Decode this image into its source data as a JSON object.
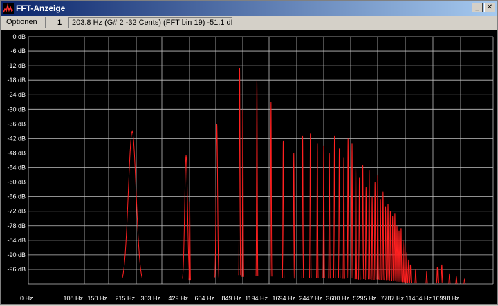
{
  "window": {
    "title": "FFT-Anzeige",
    "minimize_glyph": "_",
    "maximize_glyph": "□",
    "close_glyph": "✕",
    "app_icon": "spectrum-icon"
  },
  "toolbar": {
    "options_label": "Optionen",
    "channel_label": "1",
    "readout": "203.8 Hz (G# 2 -32 Cents) (FFT bin 19) -51.1 dB"
  },
  "colors": {
    "trace": "#ff2020",
    "grid": "#c0c0c0",
    "background": "#000000"
  },
  "chart_data": {
    "type": "line",
    "title": "",
    "xlabel": "",
    "ylabel": "",
    "x_scale": "log",
    "x_ticks": [
      "0 Hz",
      "108 Hz",
      "150 Hz",
      "215 Hz",
      "303 Hz",
      "429 Hz",
      "604 Hz",
      "849 Hz",
      "1194 Hz",
      "1694 Hz",
      "2447 Hz",
      "3600 Hz",
      "5295 Hz",
      "7787 Hz",
      "11454 Hz",
      "16998 Hz"
    ],
    "y_ticks": [
      "0 dB",
      "-6 dB",
      "-12 dB",
      "-18 dB",
      "-24 dB",
      "-30 dB",
      "-36 dB",
      "-42 dB",
      "-48 dB",
      "-54 dB",
      "-60 dB",
      "-66 dB",
      "-72 dB",
      "-78 dB",
      "-84 dB",
      "-90 dB",
      "-96 dB"
    ],
    "ylim": [
      -102,
      0
    ],
    "grid": true,
    "floor_db": -102,
    "peaks": [
      {
        "freq": 204,
        "db": -39,
        "width": 0.13
      },
      {
        "freq": 411,
        "db": -49,
        "width": 0.045
      },
      {
        "freq": 430,
        "db": -68,
        "width": 0.01
      },
      {
        "freq": 612,
        "db": -36,
        "width": 0.025
      },
      {
        "freq": 816,
        "db": -13,
        "width": 0.012
      },
      {
        "freq": 850,
        "db": -30,
        "width": 0.008
      },
      {
        "freq": 1020,
        "db": -18,
        "width": 0.012
      },
      {
        "freq": 1224,
        "db": -27,
        "width": 0.01
      },
      {
        "freq": 1428,
        "db": -43,
        "width": 0.01
      },
      {
        "freq": 1632,
        "db": -48,
        "width": 0.009
      },
      {
        "freq": 1836,
        "db": -41,
        "width": 0.009
      },
      {
        "freq": 2040,
        "db": -40,
        "width": 0.008
      },
      {
        "freq": 2244,
        "db": -44,
        "width": 0.008
      },
      {
        "freq": 2448,
        "db": -45,
        "width": 0.008
      },
      {
        "freq": 2652,
        "db": -48,
        "width": 0.008
      },
      {
        "freq": 2856,
        "db": -41,
        "width": 0.007
      },
      {
        "freq": 3060,
        "db": -46,
        "width": 0.007
      },
      {
        "freq": 3264,
        "db": -50,
        "width": 0.007
      },
      {
        "freq": 3468,
        "db": -42,
        "width": 0.007
      },
      {
        "freq": 3672,
        "db": -44,
        "width": 0.007
      },
      {
        "freq": 3876,
        "db": -54,
        "width": 0.007
      },
      {
        "freq": 4080,
        "db": -58,
        "width": 0.007
      },
      {
        "freq": 4284,
        "db": -53,
        "width": 0.006
      },
      {
        "freq": 4488,
        "db": -62,
        "width": 0.006
      },
      {
        "freq": 4692,
        "db": -55,
        "width": 0.006
      },
      {
        "freq": 4896,
        "db": -66,
        "width": 0.006
      },
      {
        "freq": 5100,
        "db": -60,
        "width": 0.006
      },
      {
        "freq": 5304,
        "db": -57,
        "width": 0.006
      },
      {
        "freq": 5508,
        "db": -67,
        "width": 0.006
      },
      {
        "freq": 5712,
        "db": -64,
        "width": 0.006
      },
      {
        "freq": 5916,
        "db": -70,
        "width": 0.006
      },
      {
        "freq": 6120,
        "db": -69,
        "width": 0.006
      },
      {
        "freq": 6324,
        "db": -72,
        "width": 0.006
      },
      {
        "freq": 6528,
        "db": -74,
        "width": 0.006
      },
      {
        "freq": 6732,
        "db": -73,
        "width": 0.006
      },
      {
        "freq": 6936,
        "db": -78,
        "width": 0.006
      },
      {
        "freq": 7140,
        "db": -80,
        "width": 0.006
      },
      {
        "freq": 7344,
        "db": -79,
        "width": 0.006
      },
      {
        "freq": 7548,
        "db": -84,
        "width": 0.006
      },
      {
        "freq": 7752,
        "db": -85,
        "width": 0.006
      },
      {
        "freq": 7956,
        "db": -89,
        "width": 0.006
      },
      {
        "freq": 8160,
        "db": -92,
        "width": 0.006
      },
      {
        "freq": 8364,
        "db": -94,
        "width": 0.006
      },
      {
        "freq": 9000,
        "db": -96,
        "width": 0.01
      },
      {
        "freq": 10500,
        "db": -97,
        "width": 0.01
      },
      {
        "freq": 12200,
        "db": -95,
        "width": 0.012
      },
      {
        "freq": 13000,
        "db": -94,
        "width": 0.012
      },
      {
        "freq": 14500,
        "db": -98,
        "width": 0.012
      },
      {
        "freq": 16000,
        "db": -99,
        "width": 0.012
      },
      {
        "freq": 18000,
        "db": -100,
        "width": 0.012
      }
    ]
  }
}
